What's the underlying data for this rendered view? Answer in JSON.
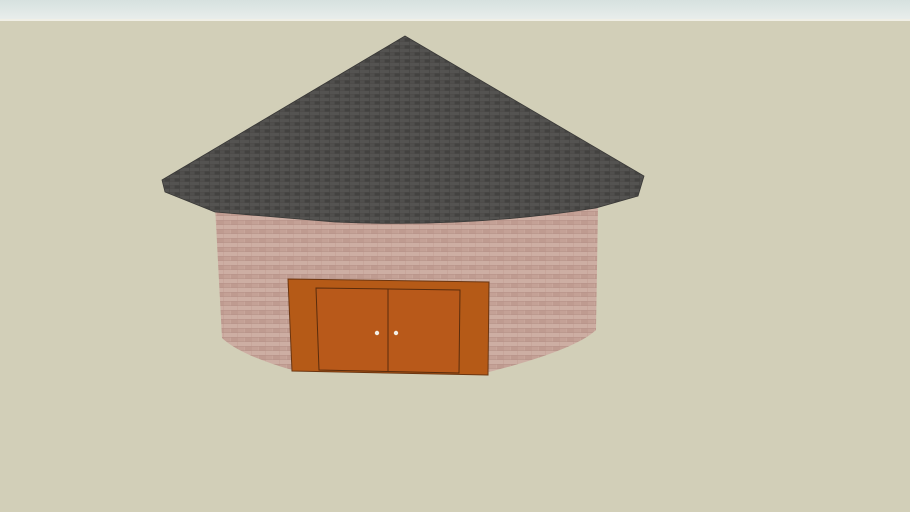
{
  "scene": {
    "sky_color": "#dce5e3",
    "ground_color": "#d2cfb8",
    "roof_color": "#4a4947",
    "wall_color": "#c9a79c",
    "door_color": "#b55a17"
  }
}
